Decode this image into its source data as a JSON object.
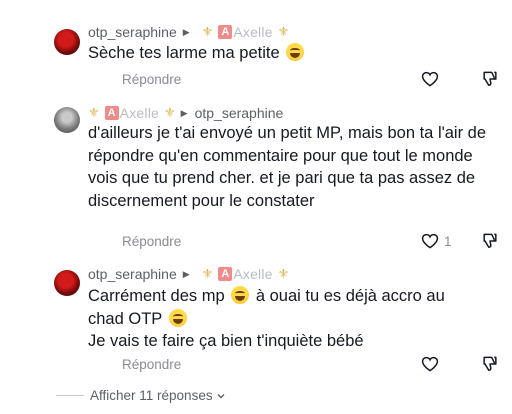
{
  "comments": [
    {
      "author": "otp_seraphine",
      "reply_to": "Axelle",
      "text": "Sèche tes larme ma petite",
      "reply_label": "Répondre",
      "likes": ""
    },
    {
      "author": "Axelle",
      "reply_to": "otp_seraphine",
      "text": "d'ailleurs je t'ai envoyé un petit MP, mais bon ta l'air de répondre qu'en commentaire pour que tout le monde vois que tu prend cher. et je pari que ta pas assez de discernement pour le constater",
      "reply_label": "Répondre",
      "likes": "1"
    },
    {
      "author": "otp_seraphine",
      "reply_to": "Axelle",
      "text_line1_a": "Carrément des mp",
      "text_line1_b": "à ouai tu es déjà accro au",
      "text_line2": "chad OTP",
      "text_line3": "Je vais te faire ça bien t'inquiète bébé",
      "reply_label": "Répondre",
      "likes": ""
    }
  ],
  "show_more": {
    "label": "Afficher 11 réponses"
  },
  "badge_letter": "A",
  "icons": {
    "reply_arrow": "triangle-right-icon",
    "fleur": "fleur-de-lis-icon",
    "like": "heart-outline-icon",
    "dislike": "thumbs-down-icon",
    "expand": "chevron-down-icon",
    "emoji": "grinning-sweat-emoji"
  },
  "colors": {
    "text": "#161823",
    "secondary": "#8a8b91",
    "fleur": "#d9b44a",
    "badge": "#f08b8b"
  }
}
